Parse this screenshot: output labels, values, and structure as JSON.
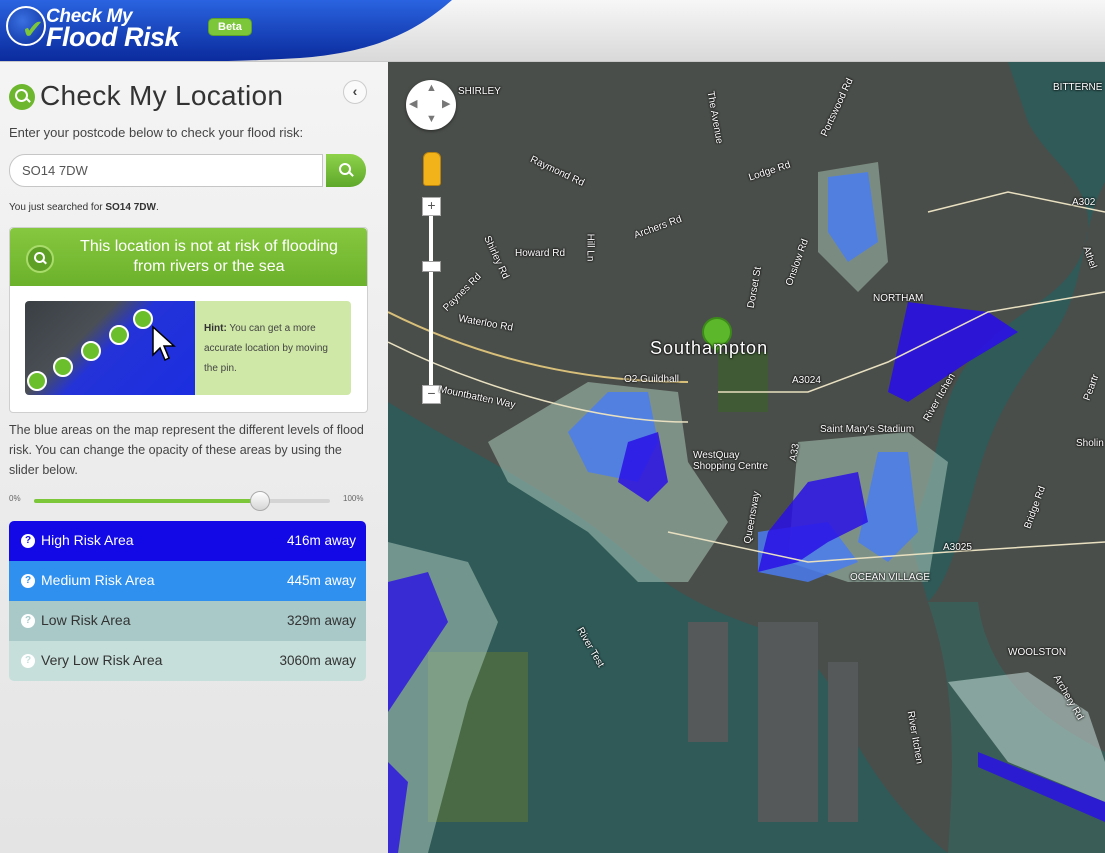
{
  "header": {
    "brand_line1": "Check My",
    "brand_line2": "Flood Risk",
    "badge": "Beta"
  },
  "sidebar": {
    "title": "Check My Location",
    "collapse_icon": "chevron-left-icon",
    "instruction": "Enter your postcode below to check your flood risk:",
    "search": {
      "value": "SO14 7DW",
      "button_icon": "search-icon"
    },
    "searched_prefix": "You just searched for ",
    "searched_value": "SO14 7DW",
    "searched_suffix": ".",
    "result": {
      "message": "This location is not at risk of flooding from rivers or the sea",
      "hint_label": "Hint:",
      "hint_text": " You can get a more accurate location by moving the pin."
    },
    "description": "The blue areas on the map represent the different levels of flood risk. You can change the opacity of these areas by using the slider below.",
    "opacity_slider": {
      "min_label": "0%",
      "max_label": "100%",
      "value_percent": 76
    },
    "risk_areas": [
      {
        "name": "High Risk Area",
        "distance": "416m away",
        "color": "#1209e6"
      },
      {
        "name": "Medium Risk Area",
        "distance": "445m away",
        "color": "#2f90f0"
      },
      {
        "name": "Low Risk Area",
        "distance": "329m away",
        "color": "#a9c9c9"
      },
      {
        "name": "Very Low Risk Area",
        "distance": "3060m away",
        "color": "#c6dfda"
      }
    ]
  },
  "map": {
    "labels": {
      "shirley": "SHIRLEY",
      "bitterne": "BITTERNE",
      "northam": "NORTHAM",
      "southampton": "Southampton",
      "guildhall": "O2 Guildhall",
      "westquay": "WestQuay Shopping Centre",
      "st_marys": "Saint Mary's Stadium",
      "ocean_village": "OCEAN VILLAGE",
      "woolston": "WOOLSTON",
      "raymond_rd": "Raymond Rd",
      "archers_rd": "Archers Rd",
      "howard_rd": "Howard Rd",
      "waterloo_rd": "Waterloo Rd",
      "paynes_rd": "Paynes Rd",
      "shirley_rd": "Shirley Rd",
      "the_avenue": "The Avenue",
      "portswood_rd": "Portswood Rd",
      "lodge_rd": "Lodge Rd",
      "onslow_rd": "Onslow Rd",
      "dorset_st": "Dorset St",
      "mountbatten_way": "Mountbatten Way",
      "a3024": "A3024",
      "a3025": "A3025",
      "a33": "A33",
      "queensway": "Queensway",
      "river_itchen": "River Itchen",
      "river_itchen_2": "River Itchen",
      "river_test": "River Test",
      "bridge_rd": "Bridge Rd",
      "archery_rd": "Archery Rd",
      "sholing": "Sholin",
      "hill_ln": "Hill Ln",
      "a302": "A302",
      "athel": "Athel",
      "peartr": "Peartr"
    }
  }
}
